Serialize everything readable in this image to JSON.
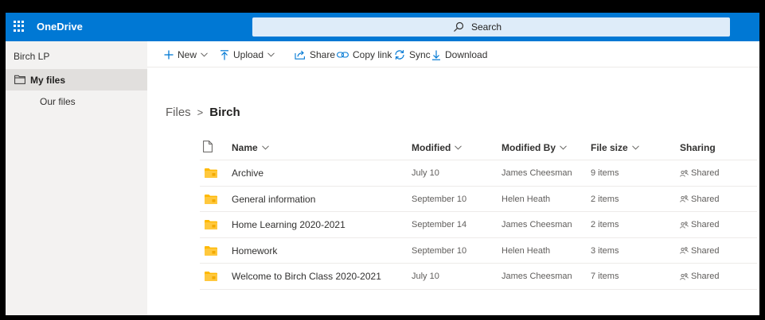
{
  "header": {
    "app_title": "OneDrive",
    "search_placeholder": "Search"
  },
  "nav": {
    "org_name": "Birch LP",
    "items": [
      {
        "label": "My files"
      },
      {
        "label": "Our files"
      }
    ]
  },
  "commands": {
    "new": "New",
    "upload": "Upload",
    "share": "Share",
    "copy_link": "Copy link",
    "sync": "Sync",
    "download": "Download"
  },
  "breadcrumb": {
    "root": "Files",
    "separator": ">",
    "current": "Birch"
  },
  "table": {
    "columns": {
      "name": "Name",
      "modified": "Modified",
      "modified_by": "Modified By",
      "file_size": "File size",
      "sharing": "Sharing"
    },
    "rows": [
      {
        "name": "Archive",
        "modified": "July 10",
        "modified_by": "James Cheesman",
        "file_size": "9 items",
        "sharing": "Shared"
      },
      {
        "name": "General information",
        "modified": "September 10",
        "modified_by": "Helen Heath",
        "file_size": "2 items",
        "sharing": "Shared"
      },
      {
        "name": "Home Learning 2020-2021",
        "modified": "September 14",
        "modified_by": "James Cheesman",
        "file_size": "2 items",
        "sharing": "Shared"
      },
      {
        "name": "Homework",
        "modified": "September 10",
        "modified_by": "Helen Heath",
        "file_size": "3 items",
        "sharing": "Shared"
      },
      {
        "name": "Welcome to Birch Class 2020-2021",
        "modified": "July 10",
        "modified_by": "James Cheesman",
        "file_size": "7 items",
        "sharing": "Shared"
      }
    ]
  },
  "colors": {
    "brand": "#0078d4",
    "folder": "#ffb900"
  }
}
